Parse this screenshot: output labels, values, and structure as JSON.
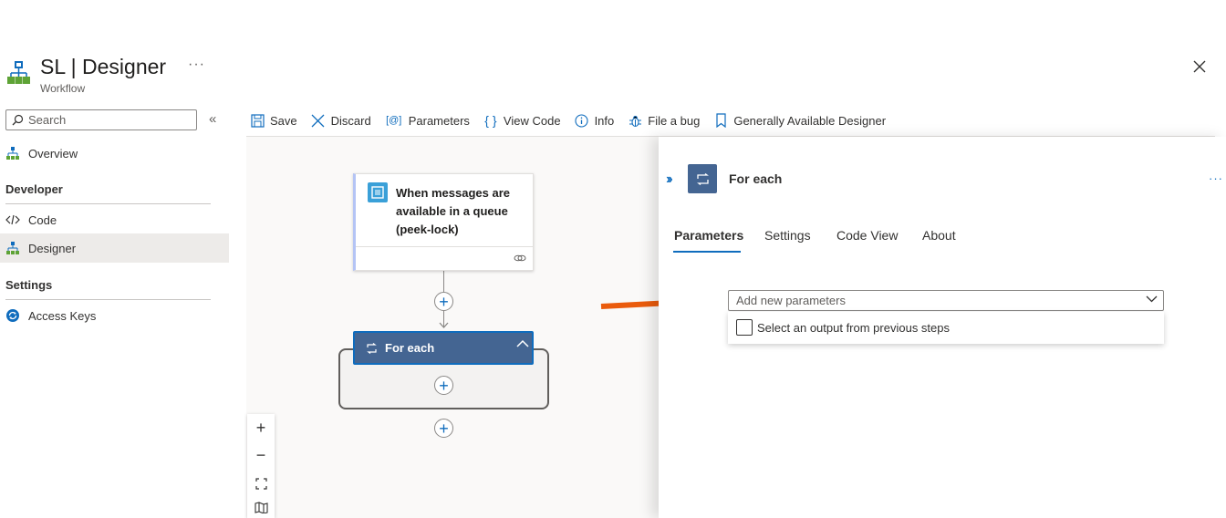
{
  "header": {
    "title": "SL | Designer",
    "subtitle": "Workflow",
    "more": "···"
  },
  "sidebar": {
    "search_placeholder": "Search",
    "collapse": "«",
    "overview": "Overview",
    "sections": [
      {
        "title": "Developer",
        "items": [
          {
            "label": "Code",
            "icon": "code-icon"
          },
          {
            "label": "Designer",
            "icon": "designer-icon",
            "selected": true
          }
        ]
      },
      {
        "title": "Settings",
        "items": [
          {
            "label": "Access Keys",
            "icon": "refresh-key-icon"
          }
        ]
      }
    ]
  },
  "toolbar": {
    "save": "Save",
    "discard": "Discard",
    "parameters": "Parameters",
    "view_code": "View Code",
    "info": "Info",
    "file_bug": "File a bug",
    "ga_designer": "Generally Available Designer"
  },
  "canvas": {
    "trigger_title": "When messages are available in a queue (peek-lock)",
    "foreach_title": "For each",
    "zoom": {
      "in": "+",
      "out": "−"
    }
  },
  "panel": {
    "title": "For each",
    "more": "···",
    "tabs": [
      "Parameters",
      "Settings",
      "Code View",
      "About"
    ],
    "active_tab": "Parameters",
    "dropdown_placeholder": "Add new parameters",
    "option_label": "Select an output from previous steps"
  },
  "colors": {
    "accent": "#0f6cbd",
    "foreach": "#446592",
    "trigger_icon": "#3aa0d8",
    "annotation": "#ea5b0c"
  }
}
